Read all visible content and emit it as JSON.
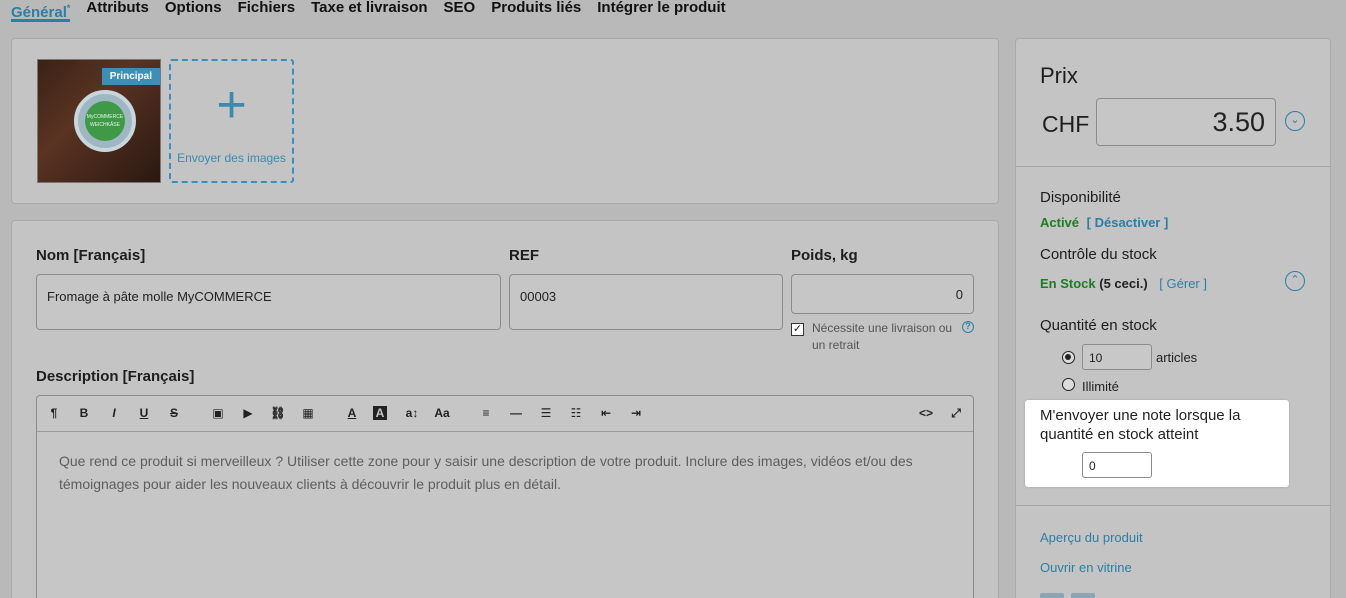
{
  "tabs": [
    {
      "label": "Général",
      "marker": "*"
    },
    {
      "label": "Attributs"
    },
    {
      "label": "Options"
    },
    {
      "label": "Fichiers"
    },
    {
      "label": "Taxe et livraison"
    },
    {
      "label": "SEO"
    },
    {
      "label": "Produits liés"
    },
    {
      "label": "Intégrer le produit"
    }
  ],
  "images": {
    "badge": "Principal",
    "cheese_brand": "MyCOMMERCE",
    "cheese_name": "WEICHKÄSE",
    "upload_label": "Envoyer des images"
  },
  "form": {
    "name_label": "Nom [Français]",
    "name_value": "Fromage à pâte molle MyCOMMERCE",
    "ref_label": "REF",
    "ref_value": "00003",
    "weight_label": "Poids, kg",
    "weight_value": "0",
    "shipping_note": "Nécessite une livraison ou un retrait",
    "desc_label": "Description [Français]",
    "desc_placeholder": "Que rend ce produit si merveilleux ? Utiliser cette zone pour y saisir une description de votre produit. Inclure des images, vidéos et/ou des témoignages pour aider les nouveaux clients à découvrir le produit plus en détail."
  },
  "toolbar": [
    "¶",
    "B",
    "I",
    "U",
    "S",
    "▣",
    "▶",
    "⛓",
    "▦",
    "A",
    "A",
    "a↕",
    "Aa",
    "≡",
    "—",
    "☰",
    "☷",
    "⇤",
    "⇥",
    "<>",
    "⤢"
  ],
  "side": {
    "price_title": "Prix",
    "currency": "CHF",
    "price": "3.50",
    "availability_label": "Disponibilité",
    "availability_status": "Activé",
    "deactivate_link": "[ Désactiver ]",
    "stock_control_label": "Contrôle du stock",
    "stock_status": "En Stock",
    "stock_count": "(5 ceci.)",
    "manage_link": "[ Gérer ]",
    "qty_label": "Quantité en stock",
    "qty_value": "10",
    "qty_unit": "articles",
    "unlimited_label": "Illimité",
    "notify_text": "M'envoyer une note lorsque la quantité en stock atteint",
    "notify_value": "0",
    "preview_link": "Aperçu du produit",
    "storefront_link": "Ouvrir en vitrine"
  },
  "colors": {
    "accent": "#2b7fa7",
    "green": "#1d7d23",
    "overlay": "#b9b9b9"
  }
}
